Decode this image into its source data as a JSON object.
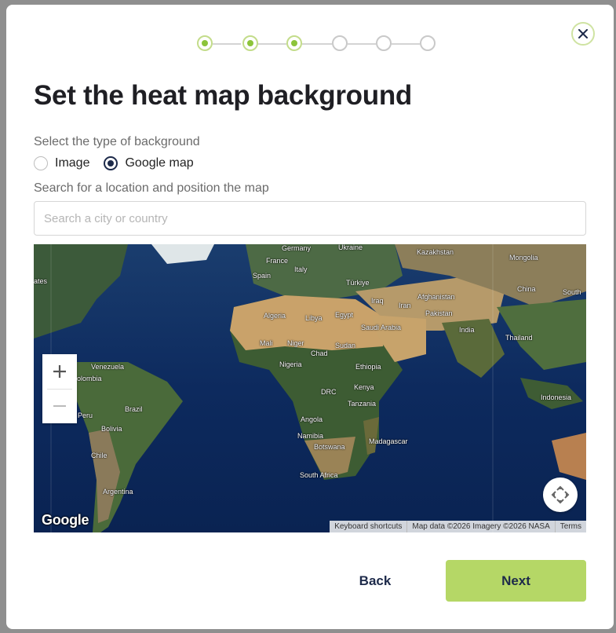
{
  "stepper": {
    "total_steps": 6,
    "completed_steps": 3
  },
  "title": "Set the heat map background",
  "background_type": {
    "label": "Select the type of background",
    "options": [
      {
        "label": "Image",
        "checked": false
      },
      {
        "label": "Google map",
        "checked": true
      }
    ]
  },
  "search": {
    "label": "Search for a location and position the map",
    "placeholder": "Search a city or country",
    "value": ""
  },
  "map": {
    "logo": "Google",
    "attribution": [
      "Keyboard shortcuts",
      "Map data ©2026 Imagery ©2026 NASA",
      "Terms"
    ],
    "zoom_in": "+",
    "zoom_out": "−",
    "labels": [
      "Germany",
      "Ukraine",
      "Kazakhstan",
      "France",
      "Mongolia",
      "Italy",
      "Spain",
      "ates",
      "Türkiye",
      "China",
      "South",
      "Iraq",
      "Afghanistan",
      "Iran",
      "Algeria",
      "Libya",
      "Egypt",
      "Pakistan",
      "Saudi Arabia",
      "India",
      "Mali",
      "Niger",
      "Sudan",
      "Thailand",
      "Chad",
      "Venezuela",
      "Nigeria",
      "Ethiopia",
      "olombia",
      "Kenya",
      "DRC",
      "Brazil",
      "Tanzania",
      "Indonesia",
      "Peru",
      "Angola",
      "Bolivia",
      "Namibia",
      "Madagascar",
      "Botswana",
      "Chile",
      "South Africa",
      "Argentina"
    ]
  },
  "buttons": {
    "back": "Back",
    "next": "Next"
  },
  "colors": {
    "accent": "#b5d766",
    "step_done": "#8cc43a",
    "dark": "#1d2a4a"
  }
}
